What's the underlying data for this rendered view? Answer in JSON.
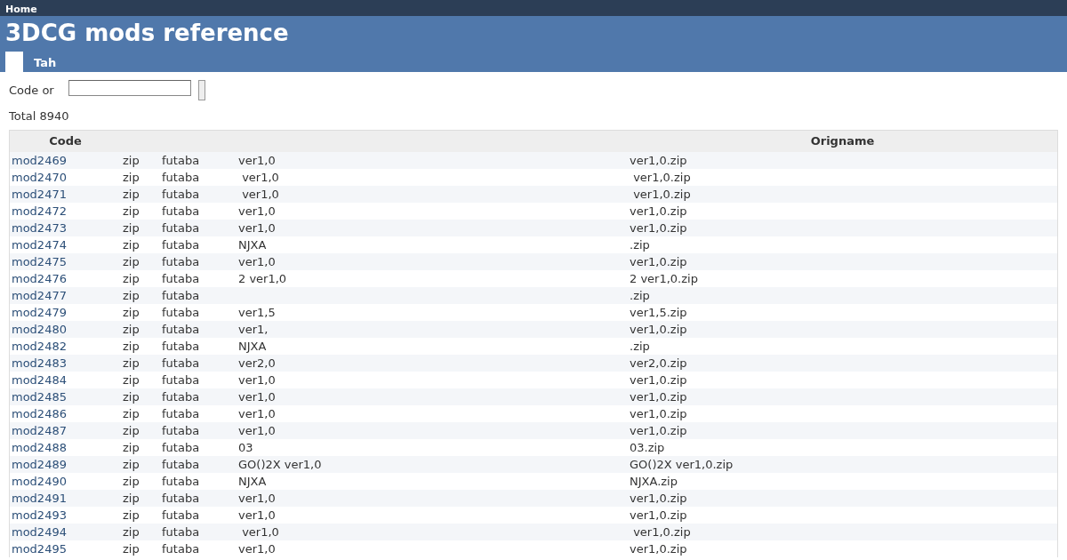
{
  "topbar": {
    "home_link": "Home"
  },
  "header": {
    "title": "3DCG mods reference"
  },
  "tabs": [
    {
      "selected": true
    },
    {
      "label": "Tah",
      "selected": false
    }
  ],
  "search": {
    "label": "Code or"
  },
  "total": "Total 8940",
  "table": {
    "columns": [
      "Code",
      "",
      "",
      "",
      "Origname"
    ],
    "rows": [
      {
        "code": "mod2469",
        "format": "zip",
        "source": "futaba",
        "name": "ver1,0",
        "origname": "ver1,0.zip"
      },
      {
        "code": "mod2470",
        "format": "zip",
        "source": "futaba",
        "name": " ver1,0",
        "origname": " ver1,0.zip"
      },
      {
        "code": "mod2471",
        "format": "zip",
        "source": "futaba",
        "name": " ver1,0",
        "origname": " ver1,0.zip"
      },
      {
        "code": "mod2472",
        "format": "zip",
        "source": "futaba",
        "name": "ver1,0",
        "origname": "ver1,0.zip"
      },
      {
        "code": "mod2473",
        "format": "zip",
        "source": "futaba",
        "name": "ver1,0",
        "origname": "ver1,0.zip"
      },
      {
        "code": "mod2474",
        "format": "zip",
        "source": "futaba",
        "name": "NJXA",
        "origname": ".zip"
      },
      {
        "code": "mod2475",
        "format": "zip",
        "source": "futaba",
        "name": "ver1,0",
        "origname": "ver1,0.zip"
      },
      {
        "code": "mod2476",
        "format": "zip",
        "source": "futaba",
        "name": "2 ver1,0",
        "origname": "2 ver1,0.zip"
      },
      {
        "code": "mod2477",
        "format": "zip",
        "source": "futaba",
        "origname": ".zip"
      },
      {
        "code": "mod2479",
        "format": "zip",
        "source": "futaba",
        "name": "ver1,5",
        "origname": "ver1,5.zip"
      },
      {
        "code": "mod2480",
        "format": "zip",
        "source": "futaba",
        "name": "ver1,",
        "origname": "ver1,0.zip"
      },
      {
        "code": "mod2482",
        "format": "zip",
        "source": "futaba",
        "name": "NJXA",
        "origname": ".zip"
      },
      {
        "code": "mod2483",
        "format": "zip",
        "source": "futaba",
        "name": "ver2,0",
        "origname": "ver2,0.zip"
      },
      {
        "code": "mod2484",
        "format": "zip",
        "source": "futaba",
        "name": "ver1,0",
        "origname": "ver1,0.zip"
      },
      {
        "code": "mod2485",
        "format": "zip",
        "source": "futaba",
        "name": "ver1,0",
        "origname": "ver1,0.zip"
      },
      {
        "code": "mod2486",
        "format": "zip",
        "source": "futaba",
        "name": "ver1,0",
        "origname": "ver1,0.zip"
      },
      {
        "code": "mod2487",
        "format": "zip",
        "source": "futaba",
        "name": "ver1,0",
        "origname": "ver1,0.zip"
      },
      {
        "code": "mod2488",
        "format": "zip",
        "source": "futaba",
        "name": "03",
        "origname": "03.zip"
      },
      {
        "code": "mod2489",
        "format": "zip",
        "source": "futaba",
        "name": "GO()2X ver1,0",
        "origname": "GO()2X ver1,0.zip"
      },
      {
        "code": "mod2490",
        "format": "zip",
        "source": "futaba",
        "name": "NJXA",
        "origname": "NJXA.zip"
      },
      {
        "code": "mod2491",
        "format": "zip",
        "source": "futaba",
        "name": "ver1,0",
        "origname": "ver1,0.zip"
      },
      {
        "code": "mod2493",
        "format": "zip",
        "source": "futaba",
        "name": "ver1,0",
        "origname": "ver1,0.zip"
      },
      {
        "code": "mod2494",
        "format": "zip",
        "source": "futaba",
        "name": " ver1,0",
        "origname": " ver1,0.zip"
      },
      {
        "code": "mod2495",
        "format": "zip",
        "source": "futaba",
        "name": "ver1,0",
        "origname": "ver1,0.zip"
      }
    ]
  }
}
